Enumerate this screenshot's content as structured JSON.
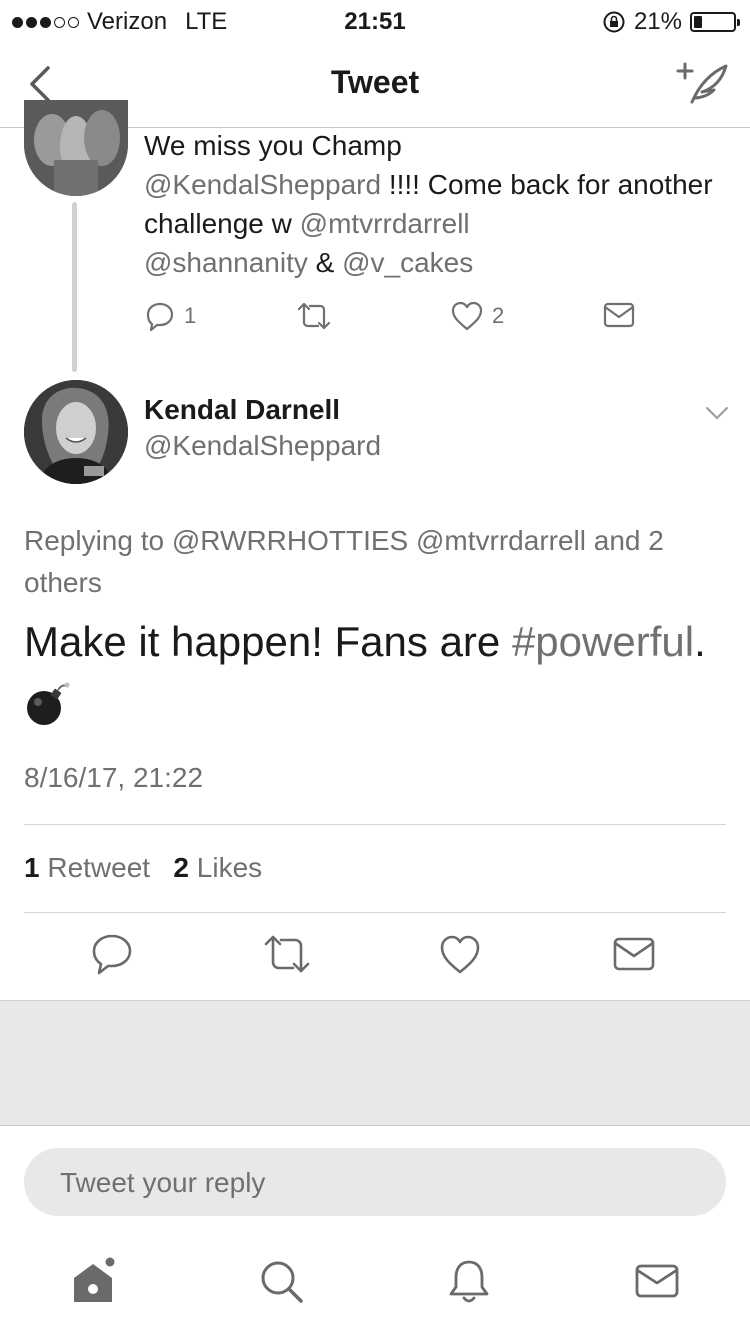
{
  "status_bar": {
    "carrier": "Verizon",
    "network": "LTE",
    "time": "21:51",
    "battery_percent": "21%",
    "battery_level": 0.21,
    "signal_filled": 3,
    "signal_total": 5
  },
  "nav": {
    "title": "Tweet"
  },
  "parent_tweet": {
    "line1": "We miss you Champ",
    "mention1": "@KendalSheppard",
    "text2": " !!!! Come back for another challenge w ",
    "mention2": "@mtvrrdarrell",
    "mention3": "@shannanity",
    "amp": " & ",
    "mention4": "@v_cakes",
    "reply_count": "1",
    "like_count": "2"
  },
  "tweet": {
    "author_name": "Kendal Darnell",
    "author_handle": "@KendalSheppard",
    "replying_prefix": "Replying to ",
    "replying_to": "@RWRRHOTTIES @mtvrrdarrell",
    "replying_suffix": " and 2 others",
    "text": "Make it happen! Fans are ",
    "hashtag": "#powerful",
    "text_end": ".",
    "timestamp": "8/16/17, 21:22",
    "retweet_count": "1",
    "retweet_label": " Retweet",
    "like_count": "2",
    "like_label": " Likes"
  },
  "reply": {
    "placeholder": "Tweet your reply"
  },
  "colors": {
    "text": "#1a1a1a",
    "muted": "#707070",
    "divider": "#d6d6d6",
    "grey_bg": "#e8e8e8"
  },
  "icons": [
    "back-chevron-icon",
    "compose-icon",
    "reply-icon",
    "retweet-icon",
    "like-icon",
    "message-icon",
    "chevron-down-icon",
    "bomb-emoji",
    "home-icon",
    "search-icon",
    "notifications-icon",
    "messages-icon"
  ]
}
